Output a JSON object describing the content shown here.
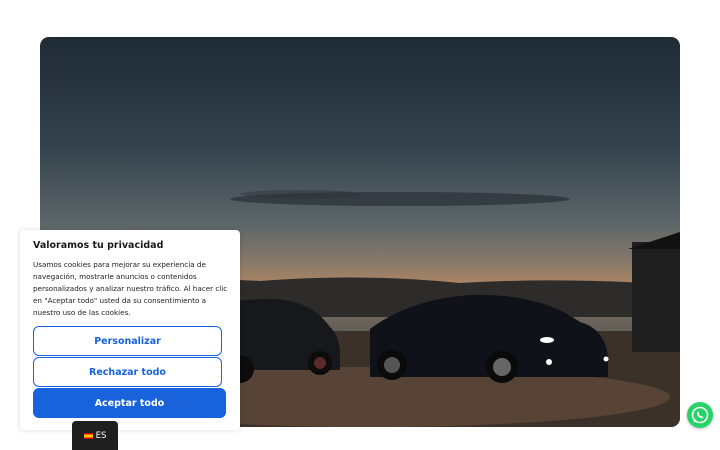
{
  "hero": {
    "image": "cars-at-dusk-photo"
  },
  "cookie_banner": {
    "title": "Valoramos tu privacidad",
    "body": "Usamos cookies para mejorar su experiencia de navegación, mostrarle anuncios o contenidos personalizados y analizar nuestro tráfico. Al hacer clic en \"Aceptar todo\" usted da su consentimiento a nuestro uso de las cookies.",
    "customize_label": "Personalizar",
    "reject_label": "Rechazar todo",
    "accept_label": "Aceptar todo",
    "accent_color": "#1863dc"
  },
  "language_switcher": {
    "flag": "spain-flag-icon",
    "label": "ES"
  },
  "whatsapp": {
    "icon": "whatsapp-icon",
    "color": "#25d366"
  }
}
